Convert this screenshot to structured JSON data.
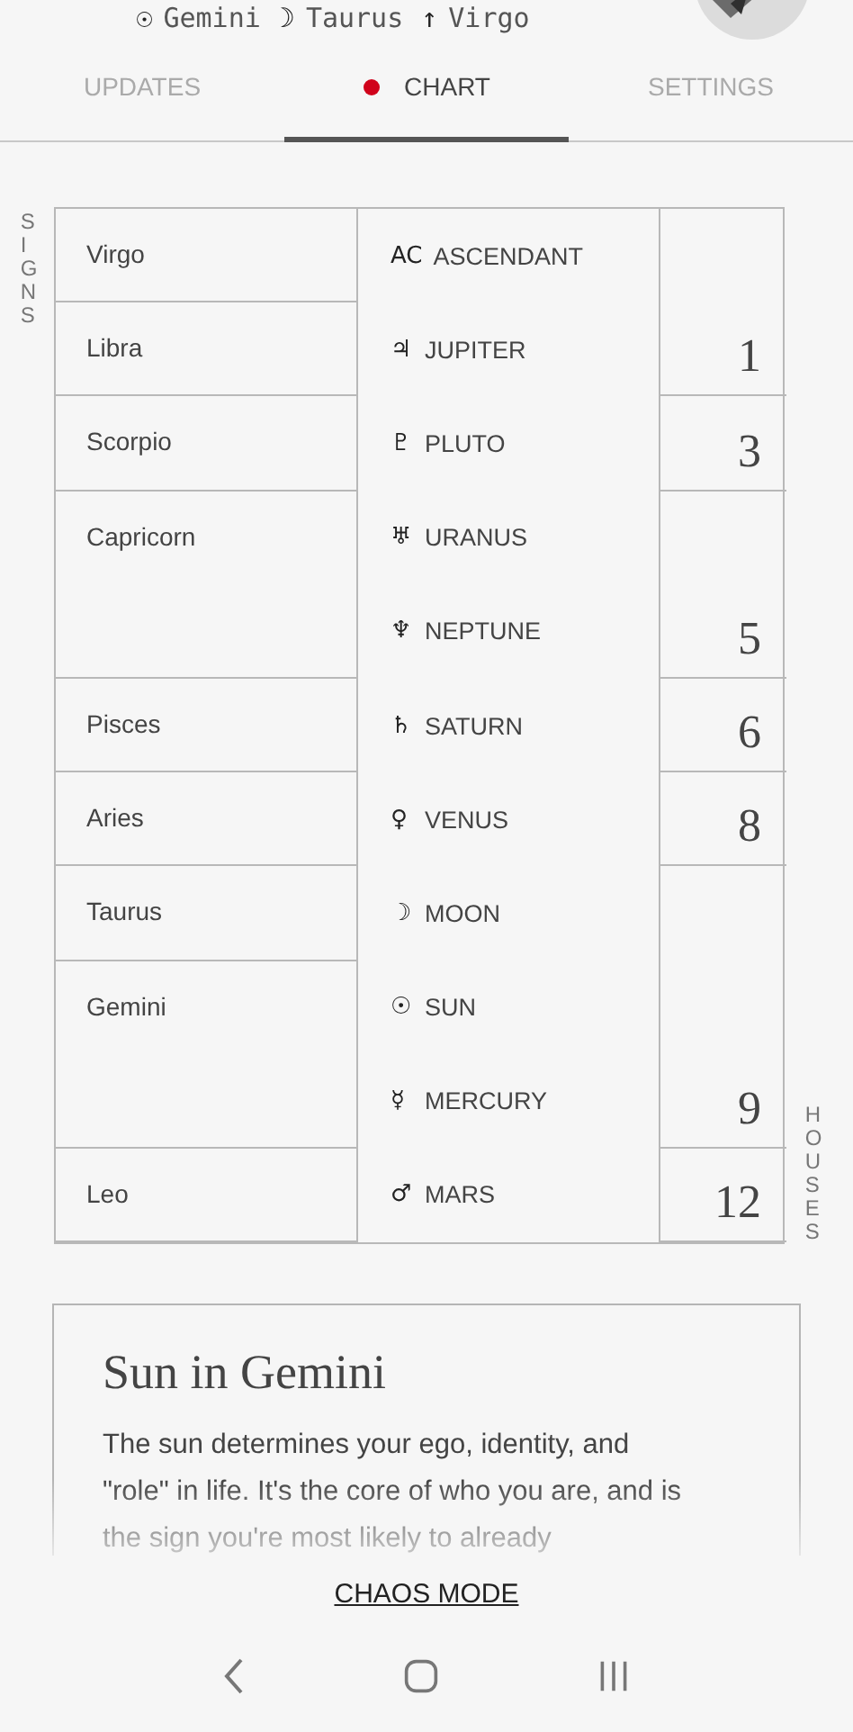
{
  "placements": [
    {
      "symbol": "☉",
      "sign": "Gemini"
    },
    {
      "symbol": "☽",
      "sign": "Taurus"
    },
    {
      "symbol": "↑",
      "sign": "Virgo"
    }
  ],
  "tabs": [
    {
      "label": "UPDATES",
      "selected": false
    },
    {
      "label": "CHART",
      "selected": true,
      "color": "#d0021b"
    },
    {
      "label": "SETTINGS",
      "selected": false
    }
  ],
  "signs_label": "SIGNS",
  "houses_label": "HOUSES",
  "rows": [
    {
      "sign": "Virgo",
      "symbol": "AC",
      "planet": "ASCENDANT"
    },
    {
      "sign": "Libra",
      "symbol": "♃",
      "planet": "JUPITER",
      "house": "1"
    },
    {
      "sign": "Scorpio",
      "symbol": "♇",
      "planet": "PLUTO",
      "house": "3"
    },
    {
      "sign": "Capricorn",
      "symbol": "♅",
      "planet": "URANUS"
    },
    {
      "symbol": "♆",
      "planet": "NEPTUNE",
      "house": "5"
    },
    {
      "sign": "Pisces",
      "symbol": "♄",
      "planet": "SATURN",
      "house": "6"
    },
    {
      "sign": "Aries",
      "symbol": "♀",
      "planet": "VENUS",
      "house": "8"
    },
    {
      "sign": "Taurus",
      "symbol": "☽",
      "planet": "MOON"
    },
    {
      "sign": "Gemini",
      "symbol": "☉",
      "planet": "SUN"
    },
    {
      "symbol": "☿",
      "planet": "MERCURY",
      "house": "9"
    },
    {
      "sign": "Leo",
      "symbol": "♂",
      "planet": "MARS",
      "house": "12"
    }
  ],
  "card": {
    "title": "Sun in Gemini",
    "text": "The sun determines your ego, identity, and \"role\" in life. It's the core of who you are, and is the sign you're most likely to already"
  },
  "link": "CHAOS MODE"
}
